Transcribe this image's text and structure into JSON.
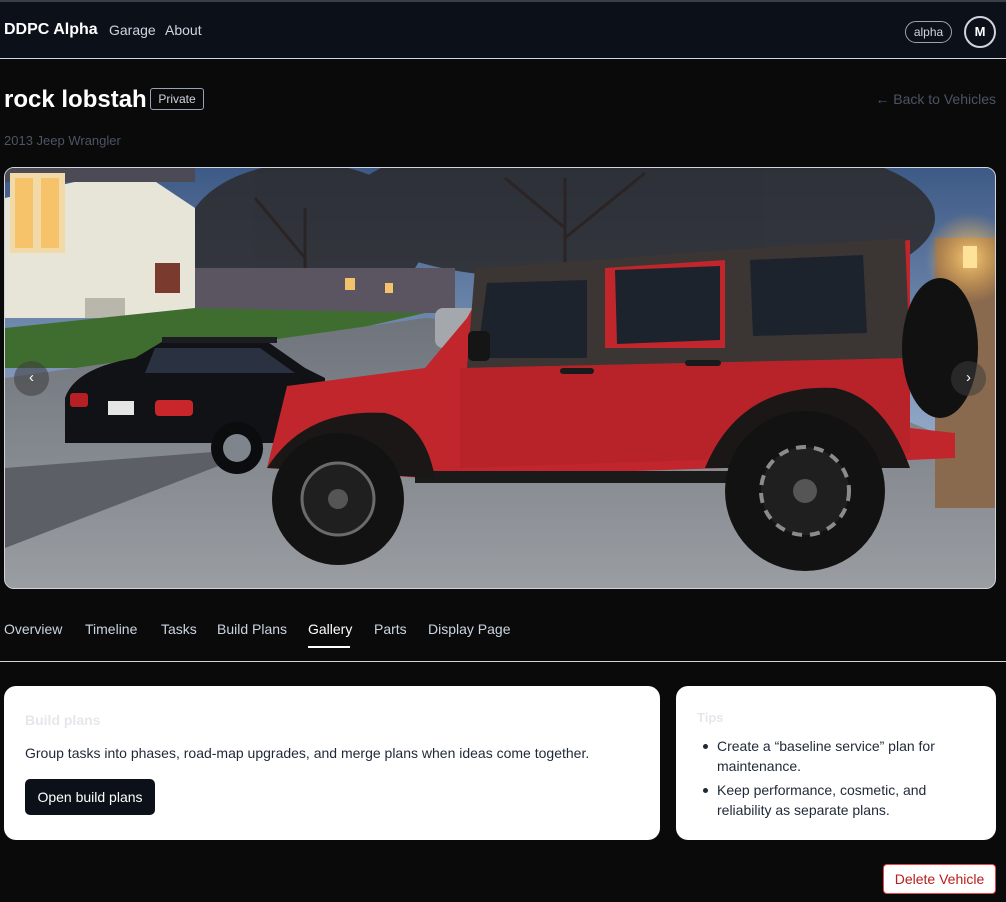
{
  "nav": {
    "brand": "DDPC Alpha",
    "links": [
      "Garage",
      "About"
    ],
    "env_badge": "alpha",
    "avatar_initial": "M"
  },
  "vehicle": {
    "name": "rock lobstah",
    "visibility": "Private",
    "subtitle": "2013 Jeep Wrangler",
    "back_link": "← Back to Vehicles"
  },
  "gallery": {
    "prev_icon": "‹",
    "next_icon": "›"
  },
  "tabs": [
    {
      "label": "Overview",
      "active": false
    },
    {
      "label": "Timeline",
      "active": false
    },
    {
      "label": "Tasks",
      "active": false
    },
    {
      "label": "Build Plans",
      "active": false
    },
    {
      "label": "Gallery",
      "active": true
    },
    {
      "label": "Parts",
      "active": false
    },
    {
      "label": "Display Page",
      "active": false
    }
  ],
  "build_plans_card": {
    "heading": "Build plans",
    "description": "Group tasks into phases, road-map upgrades, and merge plans when ideas come together.",
    "button": "Open build plans"
  },
  "tips_card": {
    "heading": "Tips",
    "items": [
      "Create a “baseline service” plan for maintenance.",
      "Keep performance, cosmetic, and reliability as separate plans."
    ]
  },
  "actions": {
    "delete": "Delete Vehicle"
  },
  "colors": {
    "background": "#0a0a0a",
    "topbar": "#0b1019",
    "primary_button": "#0b1019",
    "danger": "#b91c1c",
    "jeep_red": "#c0262b"
  }
}
